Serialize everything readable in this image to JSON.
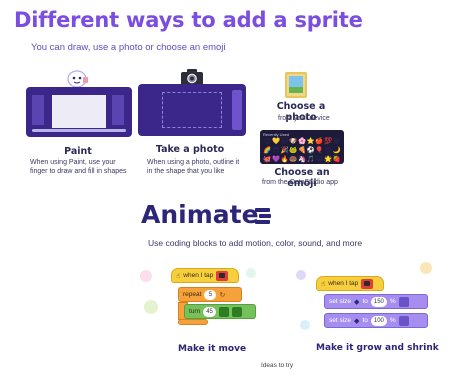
{
  "top": {
    "title": "Different ways to add a sprite",
    "subtitle": "You can draw, use a photo or choose an emoji",
    "paint": {
      "label": "Paint",
      "desc1": "When using Paint, use your",
      "desc2": "finger to draw and fill in shapes"
    },
    "photo": {
      "label": "Take a photo",
      "desc1": "When using a photo, outline it",
      "desc2": "in the shape that you like"
    },
    "choose_photo": {
      "label": "Choose a photo",
      "desc": "from your device"
    },
    "emoji": {
      "label": "Choose an emoji",
      "desc": "from the OctoStudio app",
      "panel_header": "Recently Used",
      "items": [
        "😊",
        "💛",
        "🐱",
        "🐶",
        "🌸",
        "⭐",
        "🍎",
        "💯",
        "😀",
        "🌈",
        "😎",
        "🎉",
        "🐸",
        "🍕",
        "⚽",
        "🎈",
        "😍",
        "🌙",
        "🐙",
        "💜",
        "🔥",
        "🍩",
        "🦄",
        "🎵",
        "😺",
        "🌟",
        "🍓"
      ]
    }
  },
  "bottom": {
    "title": "Animate",
    "subtitle": "Use coding blocks to add motion, color, sound, and more",
    "move": {
      "when_tap": "when I tap",
      "repeat": "repeat",
      "repeat_count": "5",
      "turn": "turn",
      "turn_value": "45",
      "caption": "Make it move"
    },
    "grow": {
      "when_tap": "when I tap",
      "set_size": "set size",
      "to": "to",
      "size1": "150",
      "size2": "100",
      "pct": "%",
      "caption": "Make it grow and shrink"
    },
    "ideas": "Ideas to try"
  },
  "colors": {
    "title_purple": "#7b4de0",
    "navy": "#2b2678",
    "tablet": "#3b2789",
    "block_yellow": "#f7cf3e",
    "block_orange": "#f6a23b",
    "block_green": "#75c15b",
    "block_purple": "#a58ef0"
  }
}
